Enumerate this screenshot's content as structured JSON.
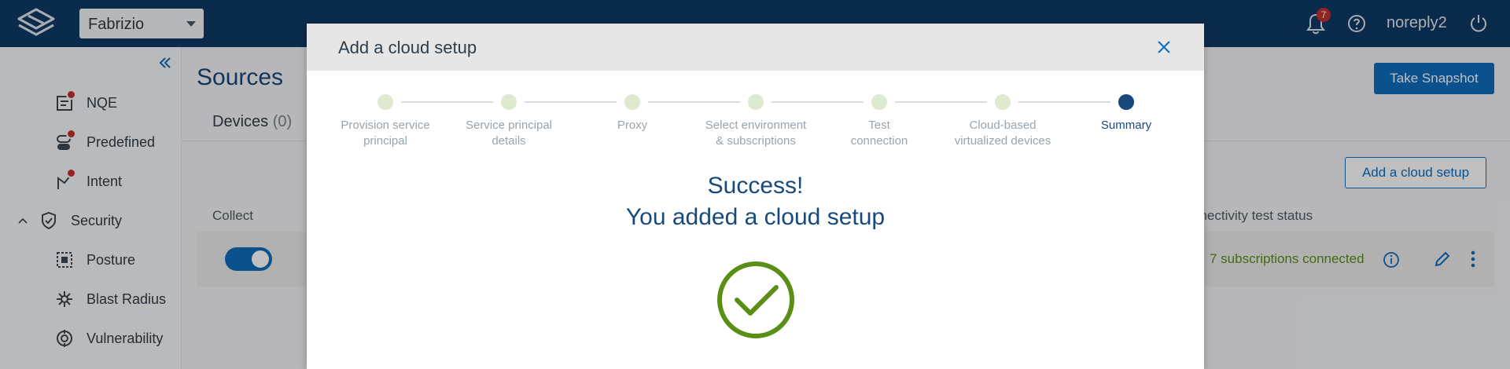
{
  "topbar": {
    "network": "Fabrizio",
    "notifications_count": "7",
    "username": "noreply2"
  },
  "sidebar": {
    "items": [
      {
        "label": "NQE"
      },
      {
        "label": "Predefined"
      },
      {
        "label": "Intent"
      },
      {
        "label": "Security"
      },
      {
        "label": "Posture"
      },
      {
        "label": "Blast Radius"
      },
      {
        "label": "Vulnerability"
      }
    ]
  },
  "main": {
    "title": "Sources",
    "tab_devices": "Devices",
    "tab_devices_count": "(0)",
    "take_snapshot": "Take Snapshot",
    "add_cloud_setup": "Add a cloud setup",
    "col_collect": "Collect",
    "col_connectivity": "nnectivity test status",
    "connectivity_status": "7 subscriptions connected"
  },
  "modal": {
    "title": "Add a cloud setup",
    "steps": [
      {
        "line1": "Provision service",
        "line2": "principal"
      },
      {
        "line1": "Service principal",
        "line2": "details"
      },
      {
        "line1": "Proxy",
        "line2": ""
      },
      {
        "line1": "Select environment",
        "line2": "& subscriptions"
      },
      {
        "line1": "Test",
        "line2": "connection"
      },
      {
        "line1": "Cloud-based",
        "line2": "virtualized devices"
      },
      {
        "line1": "Summary",
        "line2": ""
      }
    ],
    "success_line1": "Success!",
    "success_line2": "You added a cloud setup"
  },
  "colors": {
    "topbar": "#0f3a66",
    "accent": "#0f6cbd",
    "title": "#17497d",
    "success": "#5a8f16",
    "badge": "#c53030"
  }
}
